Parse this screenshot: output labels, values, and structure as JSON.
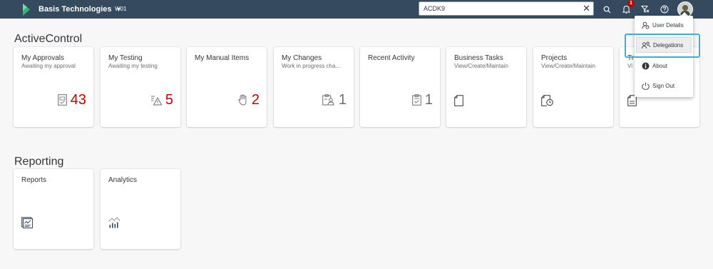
{
  "shell": {
    "brand": "Basis Technologies",
    "system_id": "W01",
    "search_value": "ACDK9",
    "notification_count": "1"
  },
  "sections": {
    "activecontrol_title": "ActiveControl",
    "reporting_title": "Reporting"
  },
  "tiles": {
    "approvals": {
      "title": "My Approvals",
      "subtitle": "Awaiting my approval",
      "count": "43",
      "icon": "approval-doc-icon"
    },
    "testing": {
      "title": "My Testing",
      "subtitle": "Awaiting my testing",
      "count": "5",
      "icon": "warning-list-icon"
    },
    "manual": {
      "title": "My Manual Items",
      "subtitle": "",
      "count": "2",
      "icon": "hand-icon"
    },
    "changes": {
      "title": "My Changes",
      "subtitle": "Work in progress cha...",
      "count": "1",
      "icon": "person-doc-icon"
    },
    "recent": {
      "title": "Recent Activity",
      "subtitle": "",
      "count": "1",
      "icon": "clipboard-check-icon"
    },
    "business": {
      "title": "Business Tasks",
      "subtitle": "View/Create/Maintain",
      "icon": "document-icon"
    },
    "projects": {
      "title": "Projects",
      "subtitle": "View/Create/Maintain",
      "icon": "document-clock-icon"
    },
    "tr": {
      "title": "Tr",
      "subtitle": "Vi",
      "icon": "document-lines-icon"
    },
    "reports": {
      "title": "Reports",
      "icon": "report-icon"
    },
    "analytics": {
      "title": "Analytics",
      "icon": "analytics-icon"
    }
  },
  "user_menu": {
    "items": [
      "User Details",
      "Delegations",
      "About",
      "Sign Out"
    ],
    "selected": "Delegations"
  },
  "colors": {
    "shell_bg": "#354a5f",
    "kpi_red": "#bb0000",
    "kpi_grey": "#6a6d70",
    "highlight": "#3bafd6"
  }
}
